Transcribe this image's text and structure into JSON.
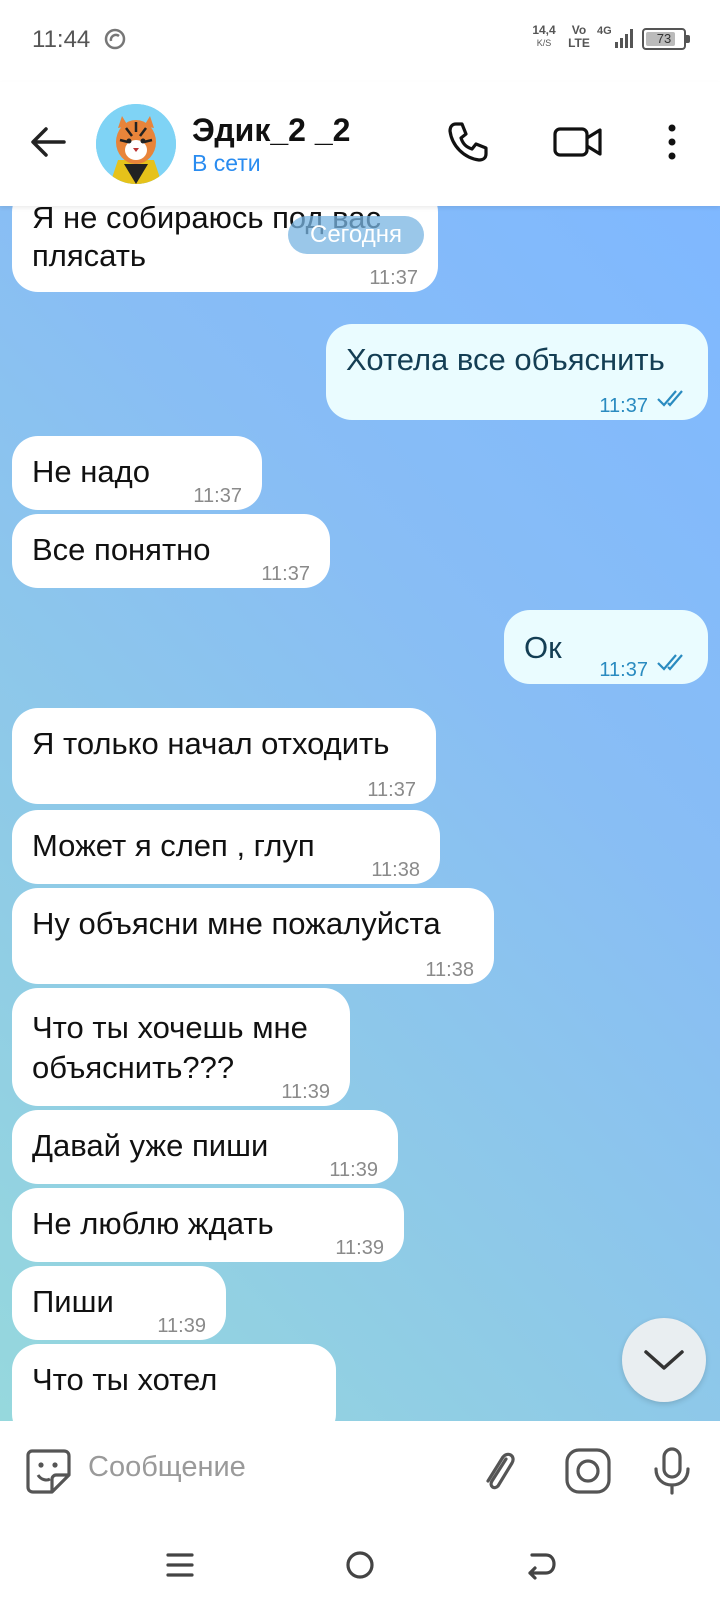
{
  "status_bar": {
    "time": "11:44",
    "net_speed": "14,4",
    "net_unit": "K/S",
    "volte_top": "Vo",
    "volte_bottom": "LTE",
    "network": "4G",
    "battery": "73"
  },
  "header": {
    "contact_name": "Эдик_2 _2",
    "status": "В сети"
  },
  "chat": {
    "date_pill": "Сегодня",
    "messages": [
      {
        "dir": "in",
        "text_line1": "Я не собираюсь под вас",
        "text_line2": "плясать",
        "time": "11:37"
      },
      {
        "dir": "out",
        "text": "Хотела все объяснить",
        "time": "11:37"
      },
      {
        "dir": "in",
        "text": "Не надо",
        "time": "11:37"
      },
      {
        "dir": "in",
        "text": "Все понятно",
        "time": "11:37"
      },
      {
        "dir": "out",
        "text": "Ок",
        "time": "11:37"
      },
      {
        "dir": "in",
        "text": "Я только начал отходить",
        "time": "11:37"
      },
      {
        "dir": "in",
        "text": "Может я слеп , глуп",
        "time": "11:38"
      },
      {
        "dir": "in",
        "text": "Ну объясни мне пожалуйста",
        "time": "11:38"
      },
      {
        "dir": "in",
        "text_line1": "Что ты хочешь мне",
        "text_line2": "объяснить???",
        "time": "11:39"
      },
      {
        "dir": "in",
        "text": "Давай уже пиши",
        "time": "11:39"
      },
      {
        "dir": "in",
        "text": "Не люблю ждать",
        "time": "11:39"
      },
      {
        "dir": "in",
        "text": "Пиши",
        "time": "11:39"
      },
      {
        "dir": "in",
        "text": "Что ты хотел",
        "time": ""
      }
    ]
  },
  "composer": {
    "placeholder": "Сообщение"
  },
  "colors": {
    "accent": "#2a8cf0",
    "outgoing_bubble": "#eafcff",
    "incoming_bubble": "#ffffff",
    "read_ticks": "#2a8bc0"
  }
}
